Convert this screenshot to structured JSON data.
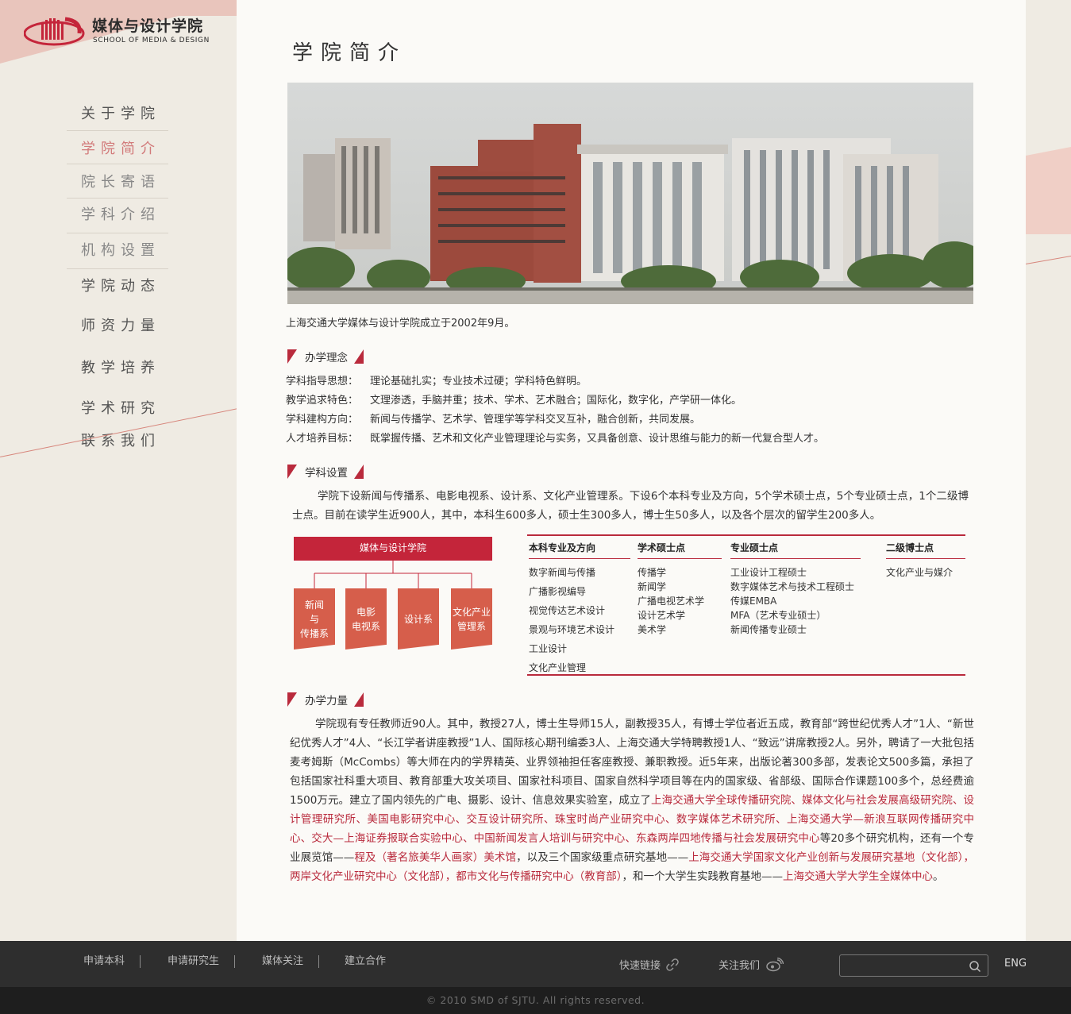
{
  "logo": {
    "cn": "媒体与设计学院",
    "en": "SCHOOL OF MEDIA & DESIGN"
  },
  "nav": {
    "items": [
      {
        "label": "关于学院",
        "state": "normal"
      },
      {
        "label": "学院简介",
        "state": "active"
      },
      {
        "label": "院长寄语",
        "state": "sub"
      },
      {
        "label": "学科介绍",
        "state": "sub"
      },
      {
        "label": "机构设置",
        "state": "sub"
      },
      {
        "label": "学院动态",
        "state": "normal"
      },
      {
        "label": "师资力量",
        "state": "normal"
      },
      {
        "label": "教学培养",
        "state": "normal"
      },
      {
        "label": "学术研究",
        "state": "normal"
      },
      {
        "label": "联系我们",
        "state": "normal"
      }
    ]
  },
  "page": {
    "title": "学院简介",
    "founded": "上海交通大学媒体与设计学院成立于2002年9月。"
  },
  "philosophy": {
    "title": "办学理念",
    "rows": [
      {
        "label": "学科指导思想：",
        "text": "理论基础扎实；专业技术过硬；学科特色鲜明。"
      },
      {
        "label": "教学追求特色：",
        "text": "文理渗透，手脑并重；技术、学术、艺术融合；国际化，数字化，产学研一体化。"
      },
      {
        "label": "学科建构方向：",
        "text": "新闻与传播学、艺术学、管理学等学科交叉互补，融合创新，共同发展。"
      },
      {
        "label": "人才培养目标：",
        "text": "既掌握传播、艺术和文化产业管理理论与实务，又具备创意、设计思维与能力的新一代复合型人才。"
      }
    ]
  },
  "disciplines": {
    "title": "学科设置",
    "text": "学院下设新闻与传播系、电影电视系、设计系、文化产业管理系。下设6个本科专业及方向，5个学术硕士点，5个专业硕士点，1个二级博士点。目前在读学生近900人，其中，本科生600多人，硕士生300多人，博士生50多人，以及各个层次的留学生200多人。",
    "org": {
      "root": "媒体与设计学院",
      "departments": [
        "新闻\n与\n传播系",
        "电影\n电视系",
        "设计系",
        "文化产业\n管理系"
      ]
    },
    "degrees": [
      {
        "head": "本科专业及方向",
        "items": [
          "数字新闻与传播",
          "广播影视编导",
          "视觉传达艺术设计",
          "景观与环境艺术设计",
          "工业设计",
          "文化产业管理"
        ]
      },
      {
        "head": "学术硕士点",
        "items": [
          "传播学",
          "新闻学",
          "广播电视艺术学",
          "设计艺术学",
          "美术学"
        ]
      },
      {
        "head": "专业硕士点",
        "items": [
          "工业设计工程硕士",
          "数字媒体艺术与技术工程硕士",
          "传媒EMBA",
          "MFA（艺术专业硕士）",
          "新闻传播专业硕士"
        ]
      },
      {
        "head": "二级博士点",
        "items": [
          "文化产业与媒介"
        ]
      }
    ]
  },
  "faculty": {
    "title": "办学力量",
    "segments": [
      {
        "t": "学院现有专任教师近90人。其中，教授27人，博士生导师15人，副教授35人，有博士学位者近五成，教育部“跨世纪优秀人才”1人、“新世纪优秀人才”4人、“长江学者讲座教授”1人、国际核心期刊编委3人、上海交通大学特聘教授1人、“致远”讲席教授2人。另外，聘请了一大批包括麦考姆斯（McCombs）等大师在内的学界精英、业界领袖担任客座教授、兼职教授。近5年来，出版论著300多部，发表论文500多篇，承担了包括国家社科重大项目、教育部重大攻关项目、国家社科项目、国家自然科学项目等在内的国家级、省部级、国际合作课题100多个，总经费逾1500万元。建立了国内领先的广电、摄影、设计、信息效果实验室，成立了",
        "h": false
      },
      {
        "t": "上海交通大学全球传播研究院、媒体文化与社会发展高级研究院、设计管理研究所、美国电影研究中心、交互设计研究所、珠宝时尚产业研究中心、数字媒体艺术研究所、上海交通大学—新浪互联网传播研究中心、交大—上海证券报联合实验中心、中国新闻发言人培训与研究中心、东森两岸四地传播与社会发展研究中心",
        "h": true
      },
      {
        "t": "等20多个研究机构，还有一个专业展览馆——",
        "h": false
      },
      {
        "t": "程及（著名旅美华人画家）美术馆",
        "h": true
      },
      {
        "t": "，以及三个国家级重点研究基地——",
        "h": false
      },
      {
        "t": "上海交通大学国家文化产业创新与发展研究基地（文化部），两岸文化产业研究中心（文化部），都市文化与传播研究中心（教育部）",
        "h": true
      },
      {
        "t": "，和一个大学生实践教育基地——",
        "h": false
      },
      {
        "t": "上海交通大学大学生全媒体中心",
        "h": true
      },
      {
        "t": "。",
        "h": false
      }
    ]
  },
  "footer": {
    "links": [
      "申请本科",
      "申请研究生",
      "媒体关注",
      "建立合作"
    ],
    "quick_links": "快速链接",
    "follow": "关注我们",
    "search_placeholder": "",
    "lang": "ENG",
    "copyright": "© 2010 SMD of SJTU. All rights reserved."
  },
  "colors": {
    "accent": "#b92a3c",
    "dept": "#d65e4b",
    "bg": "#efebe3",
    "panel": "#fbfaf7",
    "footer": "#2e2e2e"
  },
  "icons": [
    "logo-mark-icon",
    "link-icon",
    "weibo-icon",
    "search-icon"
  ]
}
